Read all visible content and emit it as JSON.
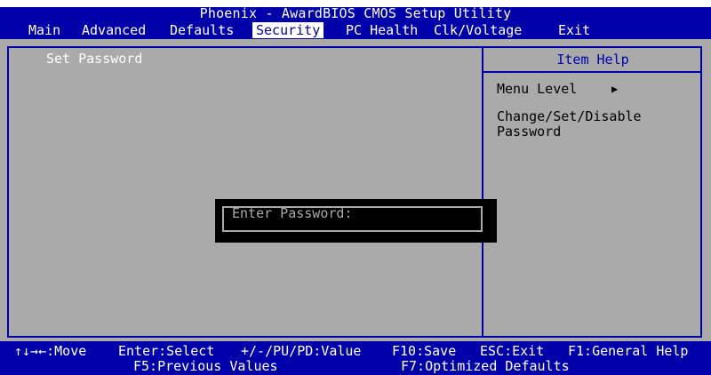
{
  "title": "Phoenix - AwardBIOS CMOS Setup Utility",
  "menu": {
    "items": [
      {
        "label": "Main"
      },
      {
        "label": "Advanced"
      },
      {
        "label": "Defaults"
      },
      {
        "label": "Security",
        "active": true
      },
      {
        "label": "PC Health"
      },
      {
        "label": "Clk/Voltage"
      },
      {
        "label": "Exit"
      }
    ]
  },
  "main": {
    "set_password_label": "Set Password"
  },
  "help": {
    "title": "Item Help",
    "menu_level_label": "Menu Level",
    "menu_level_arrow": "▶",
    "description": "Change/Set/Disable Password"
  },
  "dialog": {
    "label": "Enter Password:",
    "value": ""
  },
  "status": {
    "move": "↑↓→←:Move",
    "select": "Enter:Select",
    "value": "+/-/PU/PD:Value",
    "save": "F10:Save",
    "exit": "ESC:Exit",
    "help": "F1:General Help",
    "previous": "F5:Previous Values",
    "optimized": "F7:Optimized Defaults"
  },
  "colors": {
    "background": "#aaaaaa",
    "bar": "#0000aa",
    "highlight_text": "#ffffff",
    "dialog_bg": "#000000"
  }
}
